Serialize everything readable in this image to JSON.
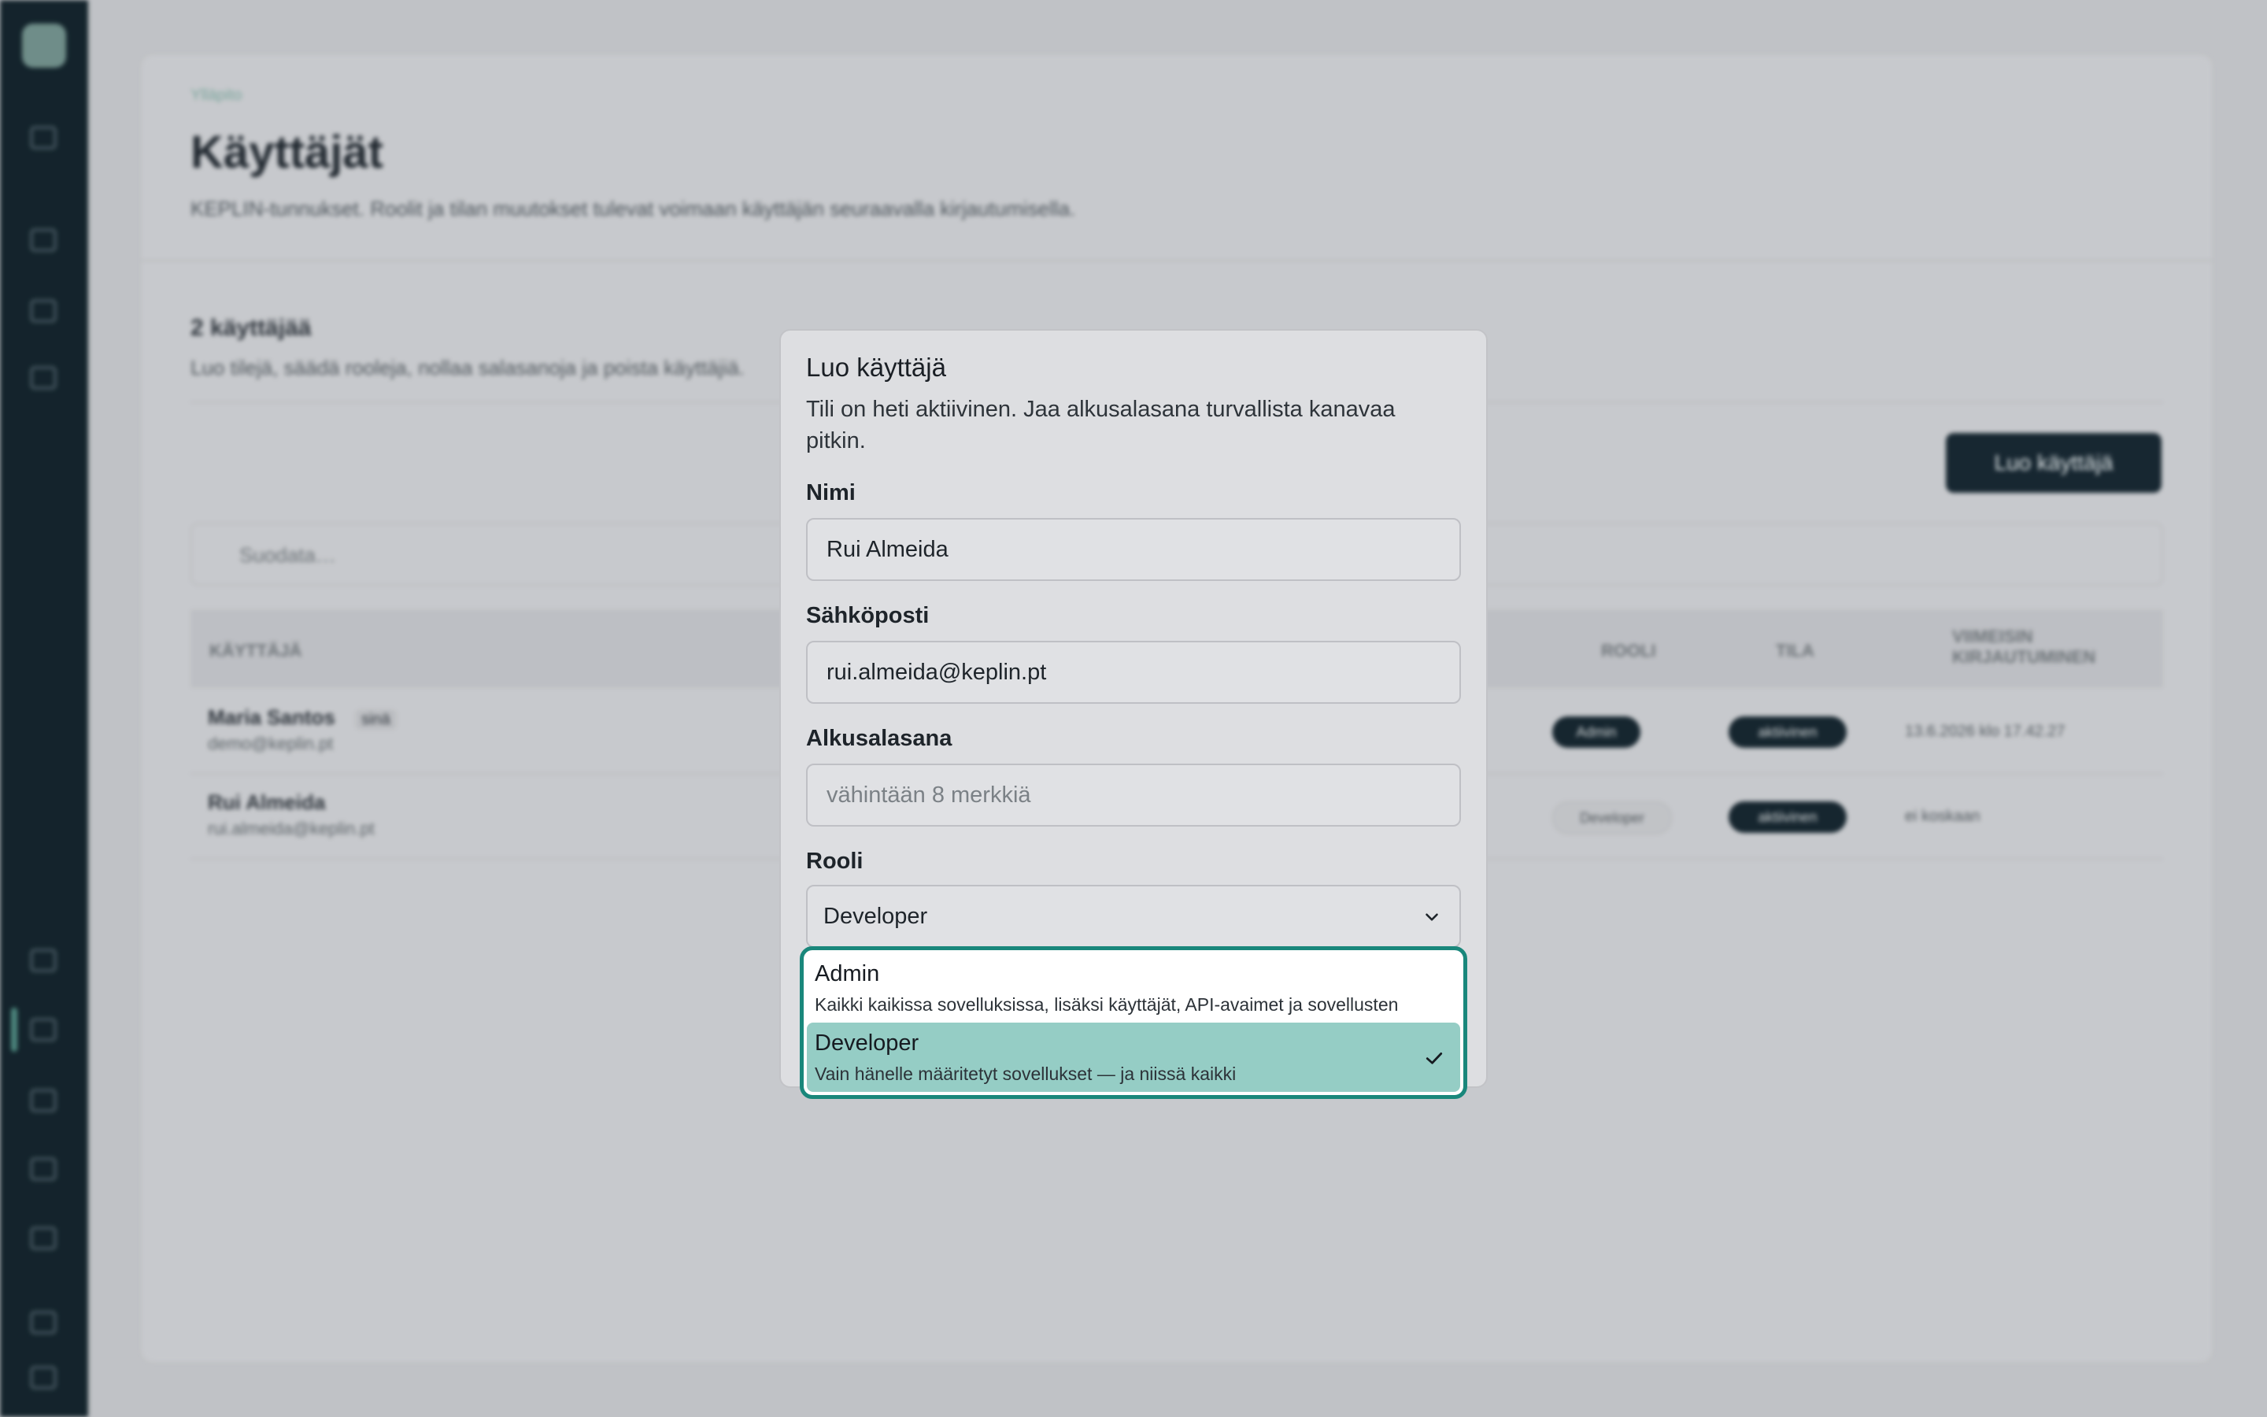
{
  "background": {
    "breadcrumb": "Ylläpito",
    "title": "Käyttäjät",
    "subtitle": "KEPLIN-tunnukset. Roolit ja tilan muutokset tulevat voimaan käyttäjän seuraavalla kirjautumisella.",
    "section_title": "2 käyttäjää",
    "section_subtitle": "Luo tilejä, säädä rooleja, nollaa salasanoja ja poista käyttäjiä.",
    "create_button": "Luo käyttäjä",
    "filter_placeholder": "Suodata…",
    "columns": {
      "user": "KÄYTTÄJÄ",
      "role": "ROOLI",
      "status": "TILA",
      "last_login": "VIIMEISIN KIRJAUTUMINEN"
    },
    "rows": [
      {
        "name": "Maria Santos",
        "you": "sinä",
        "email": "demo@keplin.pt",
        "role": "Admin",
        "status": "aktiivinen",
        "last_login": "13.6.2026 klo 17.42.27"
      },
      {
        "name": "Rui Almeida",
        "email": "rui.almeida@keplin.pt",
        "role": "Developer",
        "status": "aktiivinen",
        "last_login": "ei koskaan"
      }
    ]
  },
  "dialog": {
    "title": "Luo käyttäjä",
    "description": "Tili on heti aktiivinen. Jaa alkusalasana turvallista kanavaa pitkin.",
    "fields": {
      "name": {
        "label": "Nimi",
        "value": "Rui Almeida"
      },
      "email": {
        "label": "Sähköposti",
        "value": "rui.almeida@keplin.pt"
      },
      "password": {
        "label": "Alkusalasana",
        "placeholder": "vähintään 8 merkkiä",
        "value": ""
      },
      "role": {
        "label": "Rooli",
        "value": "Developer"
      }
    },
    "role_options": [
      {
        "label": "Admin",
        "description": "Kaikki kaikissa sovelluksissa, lisäksi käyttäjät, API-avaimet ja sovellusten",
        "selected": false
      },
      {
        "label": "Developer",
        "description": "Vain hänelle määritetyt sovellukset — ja niissä kaikki",
        "selected": true
      }
    ]
  },
  "colors": {
    "accent": "#19877b",
    "selected_bg": "#95cdc5",
    "sidebar": "#0c1c25"
  }
}
